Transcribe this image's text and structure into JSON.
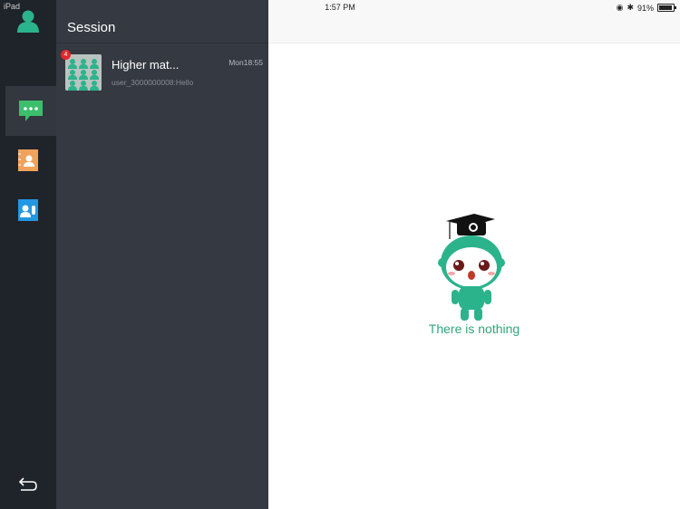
{
  "status_bar": {
    "device": "iPad",
    "time": "1:57 PM",
    "battery": "91%"
  },
  "sidebar": {
    "items": [
      {
        "name": "profile",
        "icon": "person-icon"
      },
      {
        "name": "messages",
        "icon": "chat-bubble-icon",
        "active": true
      },
      {
        "name": "contacts",
        "icon": "contact-card-icon"
      },
      {
        "name": "groups",
        "icon": "group-card-icon"
      },
      {
        "name": "back",
        "icon": "return-arrow-icon"
      }
    ]
  },
  "session_panel": {
    "title": "Session",
    "sessions": [
      {
        "name": "Higher mat...",
        "time": "Mon18:55",
        "last_message": "user_3000000008:Hello",
        "unread": "4"
      }
    ]
  },
  "main": {
    "empty_text": "There is nothing"
  },
  "colors": {
    "accent_green": "#30a77a",
    "rail_bg": "#1f232a",
    "panel_bg": "#353941",
    "badge_red": "#e5262d"
  }
}
